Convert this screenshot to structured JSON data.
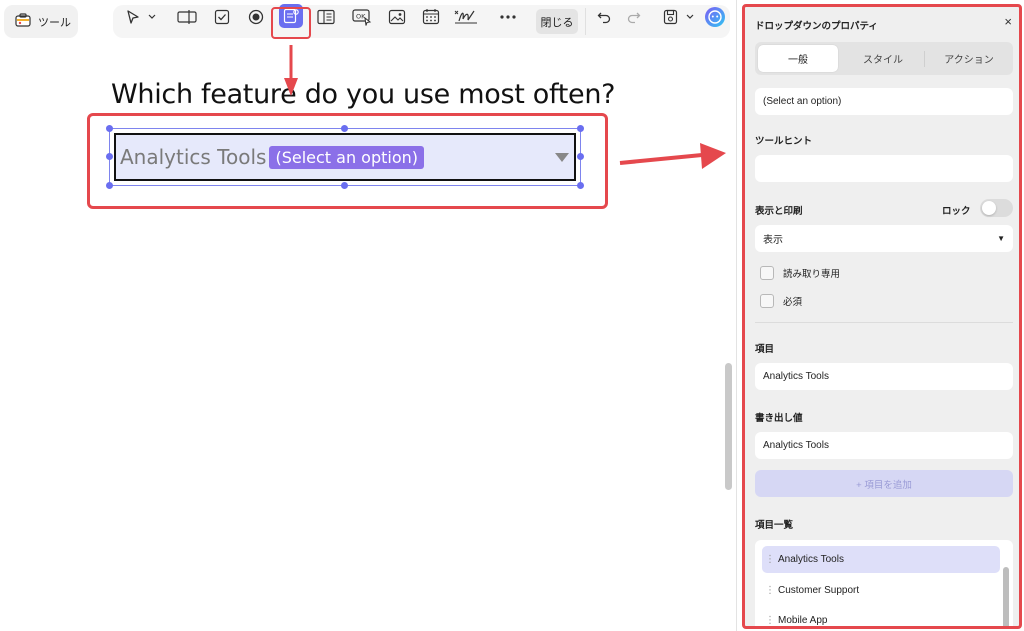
{
  "left_button": {
    "label": "ツール",
    "icon": "toolbox-icon"
  },
  "toolbar": {
    "icons": [
      "pointer-icon",
      "chevron-down-icon",
      "text-field-icon",
      "checkbox-icon",
      "radio-button-icon",
      "dropdown-field-icon",
      "list-box-icon",
      "ok-button-icon",
      "image-field-icon",
      "date-field-icon",
      "signature-icon",
      "more-icon",
      "undo-icon",
      "redo-icon",
      "save-icon",
      "chevron-down-icon",
      "ai-assistant-icon"
    ],
    "close_label": "閉じる"
  },
  "canvas": {
    "question": "Which feature do you use most often?",
    "field_value": "Analytics Tools",
    "field_chip": "(Select an option)"
  },
  "panel": {
    "title": "ドロップダウンのプロパティ",
    "close": "×",
    "tabs": [
      "一般",
      "スタイル",
      "アクション"
    ],
    "active_tab": "一般",
    "name_value": "(Select an option)",
    "tooltip_label": "ツールヒント",
    "tooltip_value": "",
    "visibility_label": "表示と印刷",
    "lock_label": "ロック",
    "visibility_value": "表示",
    "readonly_label": "読み取り専用",
    "required_label": "必須",
    "item_label": "項目",
    "item_value": "Analytics Tools",
    "export_label": "書き出し値",
    "export_value": "Analytics Tools",
    "add_button": "+ 項目を追加",
    "list_label": "項目一覧",
    "list_items": [
      "Analytics Tools",
      "Customer Support",
      "Mobile App"
    ]
  },
  "colors": {
    "accent": "#6a6ef0",
    "highlight": "#e5484d",
    "chip": "#8b70e8"
  }
}
